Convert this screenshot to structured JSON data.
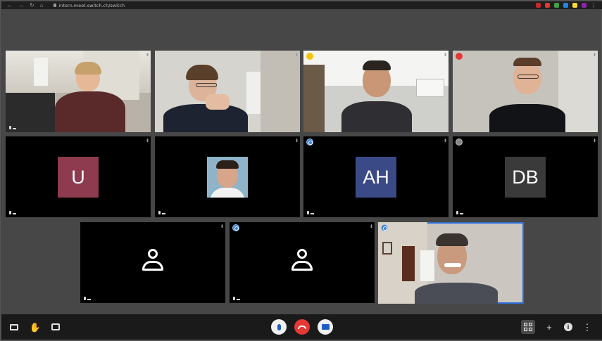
{
  "browser": {
    "url": "intern.meet.switch.ch/switch",
    "extension_colors": [
      "#c62828",
      "#e53935",
      "#43a047",
      "#1e88e5",
      "#fdd835",
      "#8e24aa"
    ]
  },
  "tiles": {
    "r3c2_initials": "U",
    "r3c4_initials": "AH",
    "r3c5_initials": "DB",
    "u_color": "#8e3a4f",
    "ah_color": "#3a4a86",
    "db_color": "#3a3a3a"
  },
  "toolbar": {
    "left": [
      "screen-share-icon",
      "raise-hand-icon",
      "chat-icon"
    ],
    "center": [
      "microphone-icon",
      "hangup-icon",
      "camera-icon"
    ],
    "right": [
      "tile-view-icon",
      "invite-icon",
      "info-icon",
      "more-icon"
    ]
  }
}
